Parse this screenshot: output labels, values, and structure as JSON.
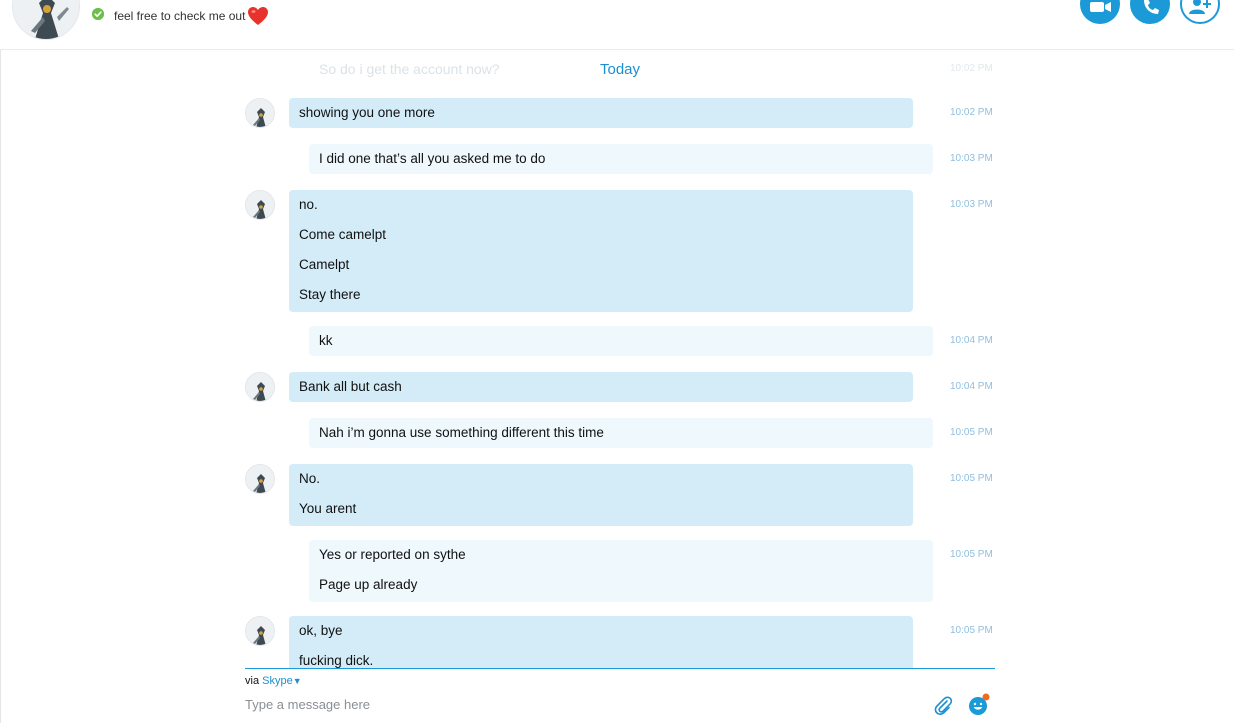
{
  "header": {
    "contact_name": "",
    "mood_text": "feel free to check me out",
    "mood_emoji": "heart-icon",
    "accent_color": "#1c9ad8",
    "status_color": "#6cc04a",
    "buttons": {
      "video": "video-call-icon",
      "call": "call-icon",
      "add": "add-people-icon"
    }
  },
  "conversation": {
    "previous_message": "So do i get the account now?",
    "previous_time": "10:02 PM",
    "date_separator": "Today",
    "messages": [
      {
        "direction": "in",
        "lines": [
          "showing you one more"
        ],
        "time": "10:02 PM"
      },
      {
        "direction": "out",
        "lines": [
          "I did one that’s all you asked me to do"
        ],
        "time": "10:03 PM"
      },
      {
        "direction": "in",
        "lines": [
          "no.",
          "Come camelpt",
          "Camelpt",
          "Stay there"
        ],
        "time": "10:03 PM"
      },
      {
        "direction": "out",
        "lines": [
          "kk"
        ],
        "time": "10:04 PM"
      },
      {
        "direction": "in",
        "lines": [
          "Bank all but cash"
        ],
        "time": "10:04 PM"
      },
      {
        "direction": "out",
        "lines": [
          "Nah i’m gonna use something different this time"
        ],
        "time": "10:05 PM"
      },
      {
        "direction": "in",
        "lines": [
          "No.",
          "You arent"
        ],
        "time": "10:05 PM"
      },
      {
        "direction": "out",
        "lines": [
          "Yes or reported on sythe",
          "Page up already"
        ],
        "time": "10:05 PM"
      },
      {
        "direction": "in",
        "lines": [
          "ok, bye",
          "fucking dick."
        ],
        "time": "10:05 PM"
      }
    ]
  },
  "compose": {
    "via_label": "via",
    "via_service": "Skype",
    "placeholder": "Type a message here",
    "value": ""
  }
}
